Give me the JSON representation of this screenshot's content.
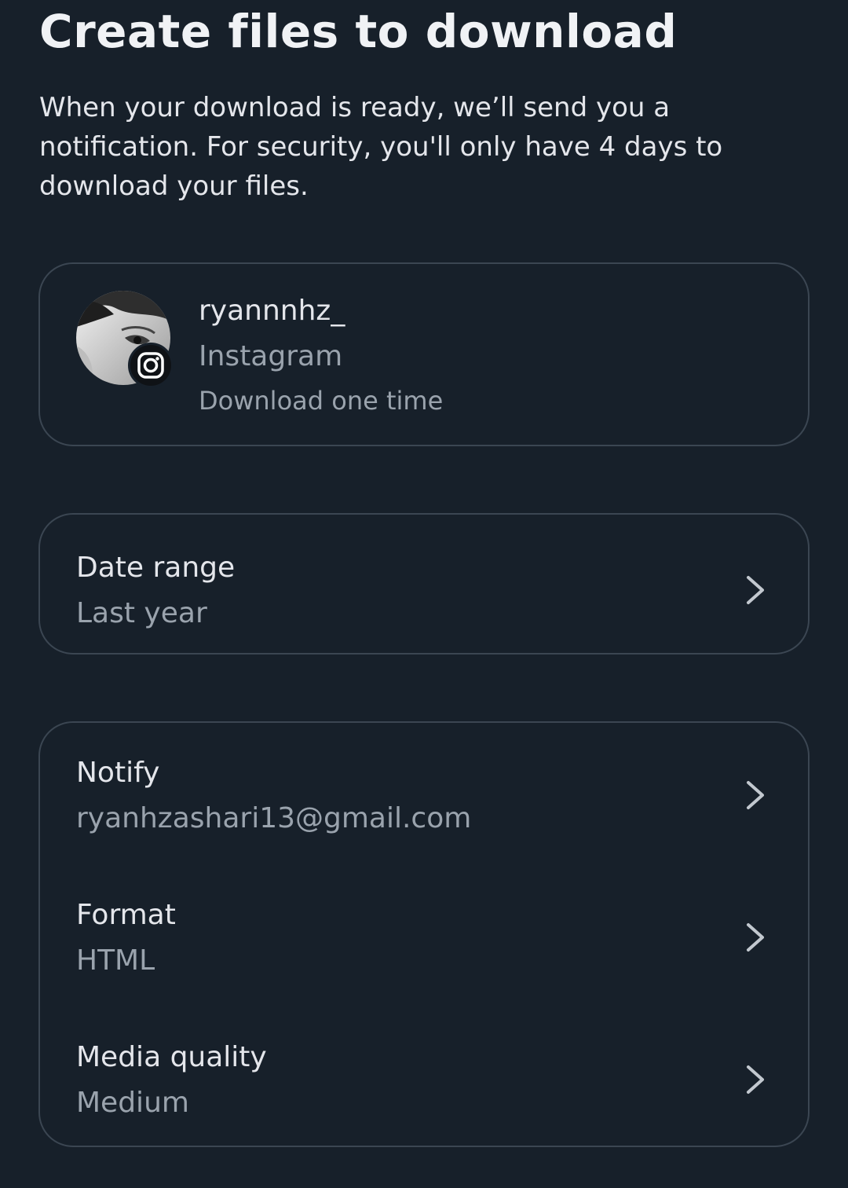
{
  "page": {
    "title": "Create files to download",
    "description": "When your download is ready, we’ll send you a notification. For security, you'll only have 4 days to download your files."
  },
  "account": {
    "username": "ryannnhz_",
    "platform": "Instagram",
    "frequency": "Download one time",
    "badge_icon": "instagram-icon"
  },
  "date_range": {
    "label": "Date range",
    "value": "Last year"
  },
  "settings": {
    "notify": {
      "label": "Notify",
      "value": "ryanhzashari13@gmail.com"
    },
    "format": {
      "label": "Format",
      "value": "HTML"
    },
    "media_quality": {
      "label": "Media quality",
      "value": "Medium"
    }
  },
  "colors": {
    "background": "#17202a",
    "card_border": "#3b4652",
    "primary_text": "#e4e6eb",
    "secondary_text": "#9aa3ad"
  }
}
